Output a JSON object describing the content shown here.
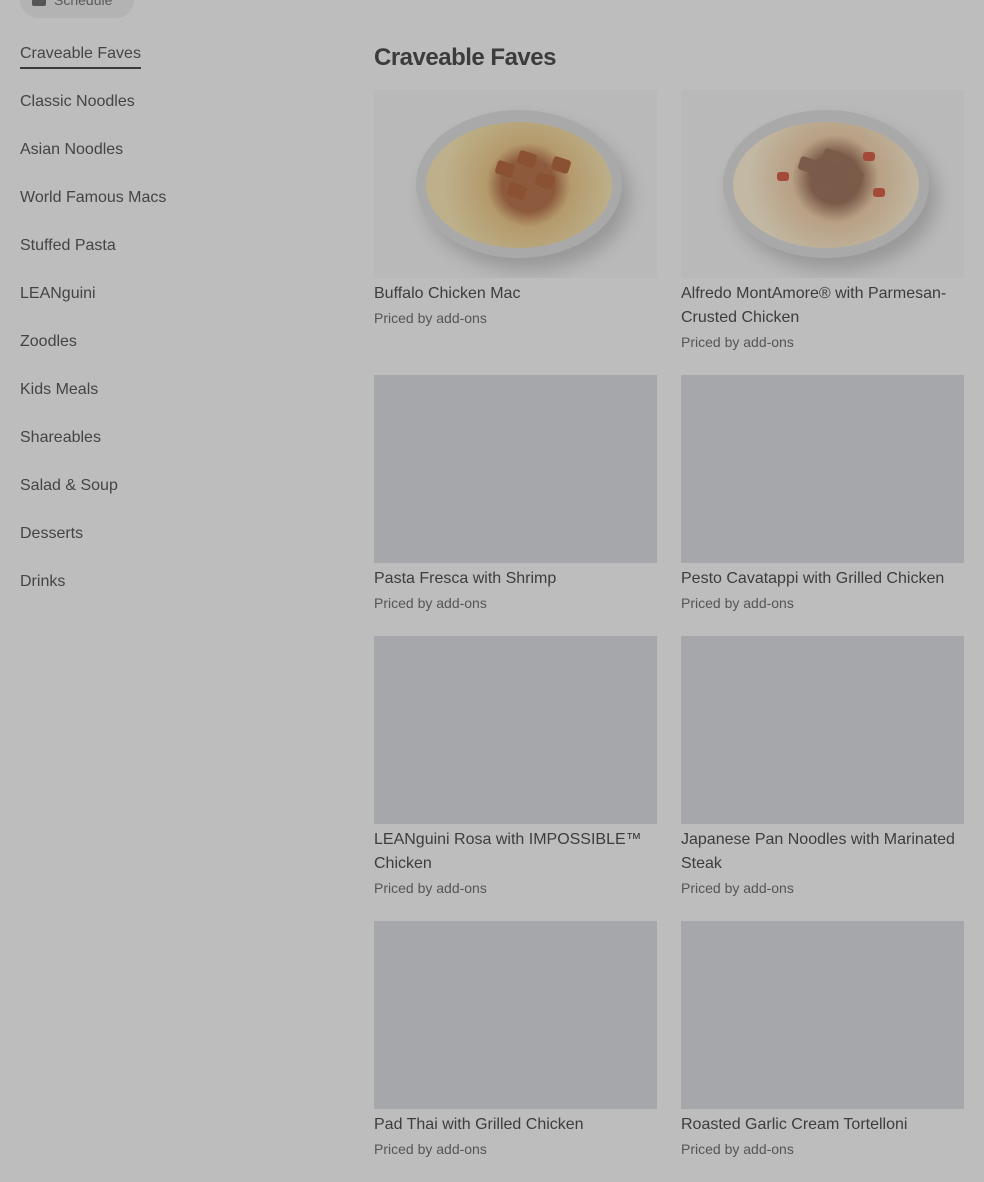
{
  "schedule": {
    "label": "Schedule"
  },
  "sidebar": {
    "items": [
      {
        "label": "Craveable Faves",
        "active": true
      },
      {
        "label": "Classic Noodles"
      },
      {
        "label": "Asian Noodles"
      },
      {
        "label": "World Famous Macs"
      },
      {
        "label": "Stuffed Pasta"
      },
      {
        "label": "LEANguini"
      },
      {
        "label": "Zoodles"
      },
      {
        "label": "Kids Meals"
      },
      {
        "label": "Shareables"
      },
      {
        "label": "Salad & Soup"
      },
      {
        "label": "Desserts"
      },
      {
        "label": "Drinks"
      }
    ]
  },
  "main": {
    "title": "Craveable Faves",
    "items": [
      {
        "name": "Buffalo Chicken Mac",
        "price": "Priced by add-ons"
      },
      {
        "name": "Alfredo MontAmore® with Parmesan-Crusted Chicken",
        "price": "Priced by add-ons"
      },
      {
        "name": "Pasta Fresca with Shrimp",
        "price": "Priced by add-ons"
      },
      {
        "name": "Pesto Cavatappi with Grilled Chicken",
        "price": "Priced by add-ons"
      },
      {
        "name": "LEANguini Rosa with IMPOSSIBLE™ Chicken",
        "price": "Priced by add-ons"
      },
      {
        "name": "Japanese Pan Noodles with Marinated Steak",
        "price": "Priced by add-ons"
      },
      {
        "name": "Pad Thai with Grilled Chicken",
        "price": "Priced by add-ons"
      },
      {
        "name": "Roasted Garlic Cream Tortelloni",
        "price": "Priced by add-ons"
      }
    ]
  },
  "colors": {
    "overlay_bg": "#bdbdbd",
    "placeholder": "#a6a7aa",
    "text": "#3d3d3d"
  }
}
